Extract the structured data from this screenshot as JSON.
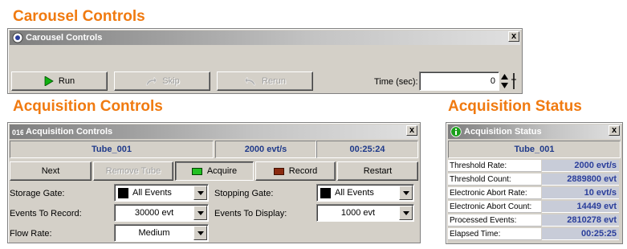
{
  "headings": {
    "carousel": "Carousel Controls",
    "acquisition_controls": "Acquisition Controls",
    "acquisition_status": "Acquisition Status"
  },
  "carousel_window": {
    "title": "Carousel Controls",
    "close_label": "x",
    "run_label": "Run",
    "skip_label": "Skip",
    "rerun_label": "Rerun",
    "time_label": "Time (sec):",
    "time_value": "0"
  },
  "acq_controls_window": {
    "title": "Acquisition Controls",
    "close_label": "x",
    "tube_name": "Tube_001",
    "rate": "2000 evt/s",
    "elapsed": "00:25:24",
    "buttons": {
      "next": "Next",
      "remove_tube": "Remove Tube",
      "acquire": "Acquire",
      "record": "Record",
      "restart": "Restart"
    },
    "storage_gate_label": "Storage Gate:",
    "storage_gate_value": "All Events",
    "stopping_gate_label": "Stopping Gate:",
    "stopping_gate_value": "All Events",
    "events_to_record_label": "Events To Record:",
    "events_to_record_value": "30000 evt",
    "events_to_display_label": "Events To Display:",
    "events_to_display_value": "1000 evt",
    "flow_rate_label": "Flow Rate:",
    "flow_rate_value": "Medium"
  },
  "acq_status_window": {
    "title": "Acquisition Status",
    "close_label": "x",
    "tube_name": "Tube_001",
    "rows": [
      {
        "label": "Threshold Rate:",
        "value": "2000 evt/s"
      },
      {
        "label": "Threshold Count:",
        "value": "2889800 evt"
      },
      {
        "label": "Electronic Abort Rate:",
        "value": "10 evt/s"
      },
      {
        "label": "Electronic Abort Count:",
        "value": "14449 evt"
      },
      {
        "label": "Processed Events:",
        "value": "2810278 evt"
      },
      {
        "label": "Elapsed Time:",
        "value": "00:25:25"
      }
    ]
  },
  "colors": {
    "heading": "#f07a10",
    "panel_text": "#1f3a8a",
    "acquire_indicator": "#22c022",
    "record_indicator": "#8a2a10",
    "run_arrow": "#10b010"
  }
}
